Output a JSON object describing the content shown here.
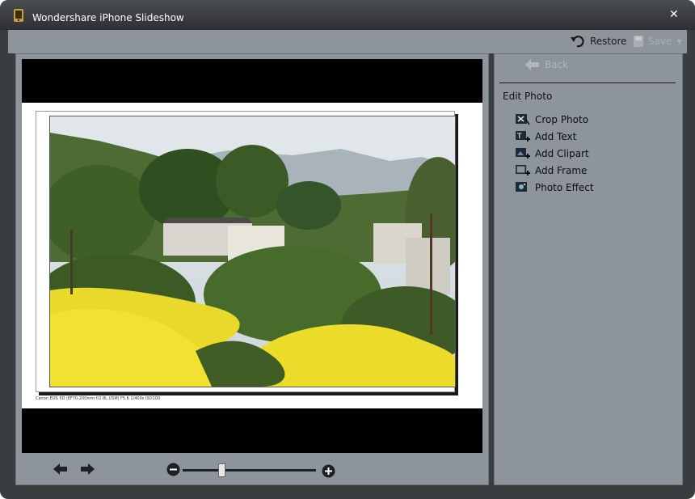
{
  "window": {
    "title": "Wondershare iPhone Slideshow",
    "close_glyph": "✕"
  },
  "toolbar": {
    "restore_label": "Restore",
    "save_label": "Save",
    "save_enabled": false
  },
  "preview": {
    "caption": "Canon EOS 5D |EF70-200mm f/2.8L USM| F5.6 1/400s ISO100",
    "photo_description_icon": "landscape-photo",
    "zoom_level": 0.3
  },
  "editor": {
    "back_label": "Back",
    "section_title": "Edit Photo",
    "items": [
      {
        "label": "Crop Photo",
        "icon": "crop-icon"
      },
      {
        "label": "Add Text",
        "icon": "add-text-icon"
      },
      {
        "label": "Add Clipart",
        "icon": "add-clipart-icon"
      },
      {
        "label": "Add Frame",
        "icon": "add-frame-icon"
      },
      {
        "label": "Photo Effect",
        "icon": "photo-effect-icon"
      }
    ]
  },
  "colors": {
    "panel": "#8d949b",
    "window_dark": "#3a3d40",
    "text_disabled": "#b2b7bc"
  }
}
